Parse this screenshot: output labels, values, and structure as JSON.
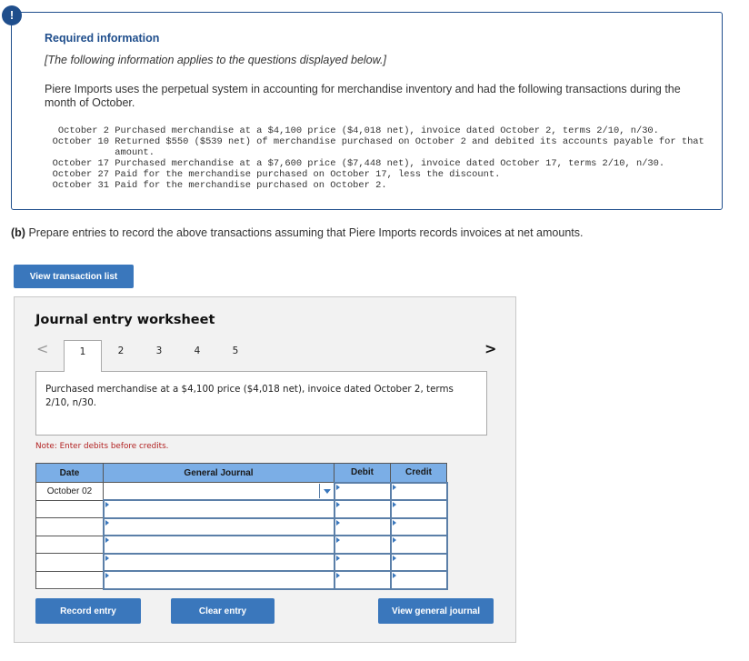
{
  "info": {
    "alert_icon": "!",
    "title": "Required information",
    "subtitle": "[The following information applies to the questions displayed below.]",
    "paragraph": "Piere Imports uses the perpetual system in accounting for merchandise inventory and had the following transactions during the month of October.",
    "transactions": [
      {
        "date": "October 2",
        "text": "Purchased merchandise at a $4,100 price ($4,018 net), invoice dated October 2, terms 2/10, n/30."
      },
      {
        "date": "October 10",
        "text": "Returned $550 ($539 net) of merchandise purchased on October 2 and debited its accounts payable for that amount."
      },
      {
        "date": "October 17",
        "text": "Purchased merchandise at a $7,600 price ($7,448 net), invoice dated October 17, terms 2/10, n/30."
      },
      {
        "date": "October 27",
        "text": "Paid for the merchandise purchased on October 17, less the discount."
      },
      {
        "date": "October 31",
        "text": "Paid for the merchandise purchased on October 2."
      }
    ]
  },
  "part_b": {
    "label": "(b)",
    "text": " Prepare entries to record the above transactions assuming that Piere Imports records invoices at net amounts."
  },
  "buttons": {
    "view_transaction_list": "View transaction list",
    "record_entry": "Record entry",
    "clear_entry": "Clear entry",
    "view_general_journal": "View general journal"
  },
  "worksheet": {
    "title": "Journal entry worksheet",
    "prev_icon": "<",
    "next_icon": ">",
    "tabs": [
      "1",
      "2",
      "3",
      "4",
      "5"
    ],
    "active_tab": "1",
    "description": "Purchased merchandise at a $4,100 price ($4,018 net), invoice dated October 2, terms 2/10, n/30.",
    "note": "Note: Enter debits before credits.",
    "table": {
      "headers": [
        "Date",
        "General Journal",
        "Debit",
        "Credit"
      ],
      "rows": [
        {
          "date": "October 02",
          "account": "",
          "debit": "",
          "credit": ""
        },
        {
          "date": "",
          "account": "",
          "debit": "",
          "credit": ""
        },
        {
          "date": "",
          "account": "",
          "debit": "",
          "credit": ""
        },
        {
          "date": "",
          "account": "",
          "debit": "",
          "credit": ""
        },
        {
          "date": "",
          "account": "",
          "debit": "",
          "credit": ""
        },
        {
          "date": "",
          "account": "",
          "debit": "",
          "credit": ""
        }
      ]
    }
  },
  "colors": {
    "accent": "#1f4e8c",
    "button": "#3a77bc",
    "table_header": "#7baee6",
    "note": "#b22222"
  }
}
